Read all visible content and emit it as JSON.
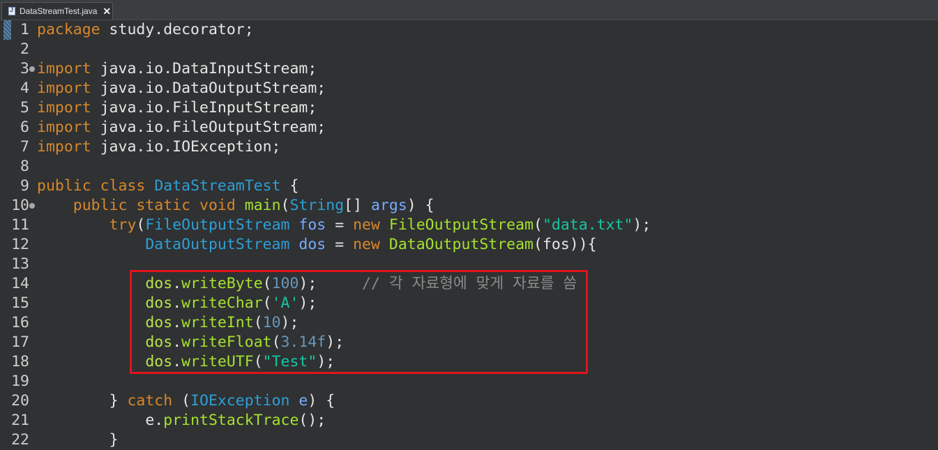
{
  "tab": {
    "filename": "DataStreamTest.java",
    "close_glyph": "✕"
  },
  "editor": {
    "lines": [
      {
        "n": "1",
        "indent": "",
        "tokens": [
          [
            "kw",
            "package"
          ],
          [
            "txt",
            " study.decorator;"
          ]
        ]
      },
      {
        "n": "2",
        "indent": "",
        "tokens": []
      },
      {
        "n": "3",
        "fold": true,
        "indent": "",
        "tokens": [
          [
            "kw",
            "import"
          ],
          [
            "txt",
            " java.io.DataInputStream;"
          ]
        ]
      },
      {
        "n": "4",
        "indent": "",
        "tokens": [
          [
            "kw",
            "import"
          ],
          [
            "txt",
            " java.io.DataOutputStream;"
          ]
        ]
      },
      {
        "n": "5",
        "indent": "",
        "tokens": [
          [
            "kw",
            "import"
          ],
          [
            "txt",
            " java.io.FileInputStream;"
          ]
        ]
      },
      {
        "n": "6",
        "indent": "",
        "tokens": [
          [
            "kw",
            "import"
          ],
          [
            "txt",
            " java.io.FileOutputStream;"
          ]
        ]
      },
      {
        "n": "7",
        "indent": "",
        "tokens": [
          [
            "kw",
            "import"
          ],
          [
            "txt",
            " java.io.IOException;"
          ]
        ]
      },
      {
        "n": "8",
        "indent": "",
        "tokens": []
      },
      {
        "n": "9",
        "indent": "",
        "tokens": [
          [
            "kw",
            "public"
          ],
          [
            "txt",
            " "
          ],
          [
            "kw",
            "class"
          ],
          [
            "txt",
            " "
          ],
          [
            "type",
            "DataStreamTest"
          ],
          [
            "txt",
            " {"
          ]
        ]
      },
      {
        "n": "10",
        "fold": true,
        "indent": "    ",
        "tokens": [
          [
            "kw",
            "public"
          ],
          [
            "txt",
            " "
          ],
          [
            "kw",
            "static"
          ],
          [
            "txt",
            " "
          ],
          [
            "kw",
            "void"
          ],
          [
            "txt",
            " "
          ],
          [
            "fn",
            "main"
          ],
          [
            "txt",
            "("
          ],
          [
            "type",
            "String"
          ],
          [
            "txt",
            "[] "
          ],
          [
            "var",
            "args"
          ],
          [
            "txt",
            ") {"
          ]
        ]
      },
      {
        "n": "11",
        "indent": "        ",
        "tokens": [
          [
            "kw",
            "try"
          ],
          [
            "txt",
            "("
          ],
          [
            "type",
            "FileOutputStream"
          ],
          [
            "txt",
            " "
          ],
          [
            "var",
            "fos"
          ],
          [
            "txt",
            " = "
          ],
          [
            "kw",
            "new"
          ],
          [
            "txt",
            " "
          ],
          [
            "fn",
            "FileOutputStream"
          ],
          [
            "txt",
            "("
          ],
          [
            "str",
            "\"data.txt\""
          ],
          [
            "txt",
            ");"
          ]
        ]
      },
      {
        "n": "12",
        "indent": "            ",
        "tokens": [
          [
            "type",
            "DataOutputStream"
          ],
          [
            "txt",
            " "
          ],
          [
            "var",
            "dos"
          ],
          [
            "txt",
            " = "
          ],
          [
            "kw",
            "new"
          ],
          [
            "txt",
            " "
          ],
          [
            "fn",
            "DataOutputStream"
          ],
          [
            "txt",
            "(fos)){"
          ]
        ]
      },
      {
        "n": "13",
        "indent": "",
        "tokens": []
      },
      {
        "n": "14",
        "indent": "            ",
        "tokens": [
          [
            "dos",
            "dos"
          ],
          [
            "txt",
            "."
          ],
          [
            "fn",
            "writeByte"
          ],
          [
            "txt",
            "("
          ],
          [
            "num",
            "100"
          ],
          [
            "txt",
            ");     "
          ],
          [
            "cmt",
            "// 각 자료형에 맞게 자료를 씀"
          ]
        ]
      },
      {
        "n": "15",
        "indent": "            ",
        "tokens": [
          [
            "dos",
            "dos"
          ],
          [
            "txt",
            "."
          ],
          [
            "fn",
            "writeChar"
          ],
          [
            "txt",
            "("
          ],
          [
            "str",
            "'A'"
          ],
          [
            "txt",
            ");"
          ]
        ]
      },
      {
        "n": "16",
        "indent": "            ",
        "tokens": [
          [
            "dos",
            "dos"
          ],
          [
            "txt",
            "."
          ],
          [
            "fn",
            "writeInt"
          ],
          [
            "txt",
            "("
          ],
          [
            "num",
            "10"
          ],
          [
            "txt",
            ");"
          ]
        ]
      },
      {
        "n": "17",
        "indent": "            ",
        "tokens": [
          [
            "dos",
            "dos"
          ],
          [
            "txt",
            "."
          ],
          [
            "fn",
            "writeFloat"
          ],
          [
            "txt",
            "("
          ],
          [
            "num",
            "3.14f"
          ],
          [
            "txt",
            ");"
          ]
        ]
      },
      {
        "n": "18",
        "indent": "            ",
        "tokens": [
          [
            "dos",
            "dos"
          ],
          [
            "txt",
            "."
          ],
          [
            "fn",
            "writeUTF"
          ],
          [
            "txt",
            "("
          ],
          [
            "str",
            "\"Test\""
          ],
          [
            "txt",
            ");"
          ]
        ]
      },
      {
        "n": "19",
        "indent": "",
        "tokens": []
      },
      {
        "n": "20",
        "indent": "        ",
        "tokens": [
          [
            "txt",
            "} "
          ],
          [
            "kw",
            "catch"
          ],
          [
            "txt",
            " ("
          ],
          [
            "type",
            "IOException"
          ],
          [
            "txt",
            " "
          ],
          [
            "var",
            "e"
          ],
          [
            "txt",
            ") {"
          ]
        ]
      },
      {
        "n": "21",
        "indent": "            ",
        "tokens": [
          [
            "txt",
            "e."
          ],
          [
            "fn",
            "printStackTrace"
          ],
          [
            "txt",
            "();"
          ]
        ]
      },
      {
        "n": "22",
        "indent": "        ",
        "tokens": [
          [
            "txt",
            "}"
          ]
        ]
      }
    ]
  }
}
